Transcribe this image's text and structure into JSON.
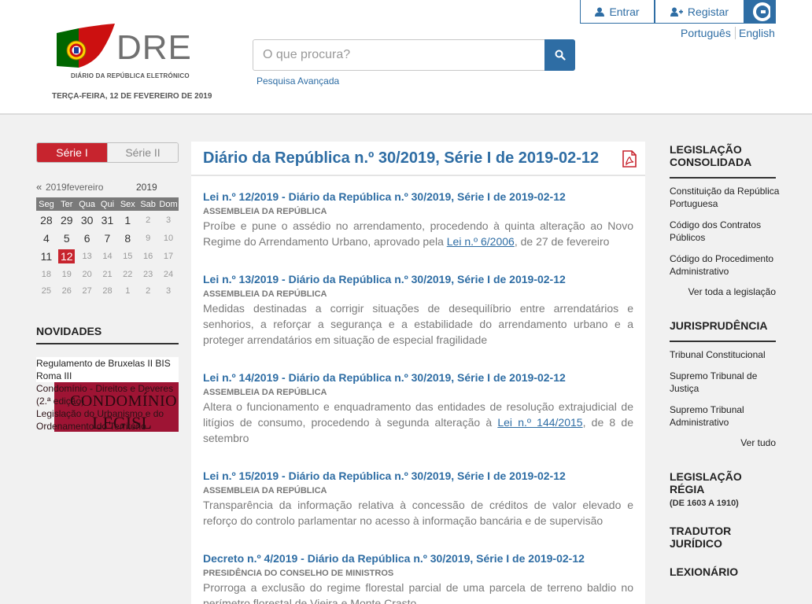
{
  "header": {
    "logo_text": "DRE",
    "logo_subtitle": "DIÁRIO DA REPÚBLICA ELETRÓNICO",
    "date": "TERÇA-FEIRA, 12 DE FEVEREIRO DE 2019",
    "search_placeholder": "O que procura?",
    "advanced_search": "Pesquisa Avançada",
    "login": "Entrar",
    "register": "Registar",
    "lang_pt": "Português",
    "lang_en": "English"
  },
  "sidebar_left": {
    "serie_tabs": [
      "Série I",
      "Série II"
    ],
    "calendar": {
      "prev": "«",
      "month": "2019fevereiro",
      "year": "2019",
      "weekdays": [
        "Seg",
        "Ter",
        "Qua",
        "Qui",
        "Sex",
        "Sab",
        "Dom"
      ],
      "weeks": [
        [
          {
            "d": "28",
            "c": "cur"
          },
          {
            "d": "29",
            "c": "cur"
          },
          {
            "d": "30",
            "c": "cur"
          },
          {
            "d": "31",
            "c": "cur"
          },
          {
            "d": "1",
            "c": "cur"
          },
          {
            "d": "2",
            "c": "oth"
          },
          {
            "d": "3",
            "c": "oth"
          }
        ],
        [
          {
            "d": "4",
            "c": "cur"
          },
          {
            "d": "5",
            "c": "cur"
          },
          {
            "d": "6",
            "c": "cur"
          },
          {
            "d": "7",
            "c": "cur"
          },
          {
            "d": "8",
            "c": "cur"
          },
          {
            "d": "9",
            "c": "oth"
          },
          {
            "d": "10",
            "c": "oth"
          }
        ],
        [
          {
            "d": "11",
            "c": "cur"
          },
          {
            "d": "12",
            "c": "today"
          },
          {
            "d": "13",
            "c": "oth"
          },
          {
            "d": "14",
            "c": "oth"
          },
          {
            "d": "15",
            "c": "oth"
          },
          {
            "d": "16",
            "c": "oth"
          },
          {
            "d": "17",
            "c": "oth"
          }
        ],
        [
          {
            "d": "18",
            "c": "oth"
          },
          {
            "d": "19",
            "c": "oth"
          },
          {
            "d": "20",
            "c": "oth"
          },
          {
            "d": "21",
            "c": "oth"
          },
          {
            "d": "22",
            "c": "oth"
          },
          {
            "d": "23",
            "c": "oth"
          },
          {
            "d": "24",
            "c": "oth"
          }
        ],
        [
          {
            "d": "25",
            "c": "oth"
          },
          {
            "d": "26",
            "c": "oth"
          },
          {
            "d": "27",
            "c": "oth"
          },
          {
            "d": "28",
            "c": "oth"
          },
          {
            "d": "1",
            "c": "oth"
          },
          {
            "d": "2",
            "c": "oth"
          },
          {
            "d": "3",
            "c": "oth"
          }
        ]
      ]
    },
    "novidades_title": "NOVIDADES",
    "novidades": [
      "Regulamento de Bruxelas II BIS Roma III",
      "Condomínio - Direitos e Deveres (2.ª edição)",
      "Legislação do Urbanismo e do Ordenamento do Território"
    ],
    "banner_text": "CONDOMÍNIO",
    "banner_text2": "LEGISL"
  },
  "main": {
    "title": "Diário da República n.º 30/2019, Série I de 2019-02-12",
    "entries": [
      {
        "title": "Lei n.º 12/2019 - Diário da República n.º 30/2019, Série I de 2019-02-12",
        "issuer": "ASSEMBLEIA DA REPÚBLICA",
        "desc_before": "Proíbe e pune o assédio no arrendamento, procedendo à quinta alteração ao Novo Regime do Arrendamento Urbano, aprovado pela ",
        "link": "Lei n.º 6/2006",
        "desc_after": ", de 27 de fevereiro"
      },
      {
        "title": "Lei n.º 13/2019 - Diário da República n.º 30/2019, Série I de 2019-02-12",
        "issuer": "ASSEMBLEIA DA REPÚBLICA",
        "desc_before": "Medidas destinadas a corrigir situações de desequilíbrio entre arrendatários e senhorios, a reforçar a segurança e a estabilidade do arrendamento urbano e a proteger arrendatários em situação de especial fragilidade",
        "link": "",
        "desc_after": ""
      },
      {
        "title": "Lei n.º 14/2019 - Diário da República n.º 30/2019, Série I de 2019-02-12",
        "issuer": "ASSEMBLEIA DA REPÚBLICA",
        "desc_before": "Altera o funcionamento e enquadramento das entidades de resolução extrajudicial de litígios de consumo, procedendo à segunda alteração à ",
        "link": "Lei n.º 144/2015",
        "desc_after": ", de 8 de setembro"
      },
      {
        "title": "Lei n.º 15/2019 - Diário da República n.º 30/2019, Série I de 2019-02-12",
        "issuer": "ASSEMBLEIA DA REPÚBLICA",
        "desc_before": "Transparência da informação relativa à concessão de créditos de valor elevado e reforço do controlo parlamentar no acesso à informação bancária e de supervisão",
        "link": "",
        "desc_after": ""
      },
      {
        "title": "Decreto n.º 4/2019 - Diário da República n.º 30/2019, Série I de 2019-02-12",
        "issuer": "PRESIDÊNCIA DO CONSELHO DE MINISTROS",
        "desc_before": "Prorroga a exclusão do regime florestal parcial de uma parcela de terreno baldio no perímetro florestal de Vieira e Monte Crasto",
        "link": "",
        "desc_after": ""
      }
    ]
  },
  "sidebar_right": {
    "legislacao": {
      "title": "LEGISLAÇÃO CONSOLIDADA",
      "links": [
        "Constituição da República Portuguesa",
        "Código dos Contratos Públicos",
        "Código do Procedimento Administrativo"
      ],
      "more": "Ver toda a legislação"
    },
    "jurisprudencia": {
      "title": "JURISPRUDÊNCIA",
      "links": [
        "Tribunal Constitucional",
        "Supremo Tribunal de Justiça",
        "Supremo Tribunal Administrativo"
      ],
      "more": "Ver tudo"
    },
    "legislacao_regia": {
      "title": "LEGISLAÇÃO RÉGIA",
      "subtitle": "(DE 1603 A 1910)"
    },
    "tradutor": "TRADUTOR JURÍDICO",
    "lexionario": "LEXIONÁRIO"
  },
  "colors": {
    "brand_blue": "#2e6da4",
    "brand_red": "#c7242e",
    "flag_green": "#006600",
    "flag_red": "#cc1010"
  }
}
